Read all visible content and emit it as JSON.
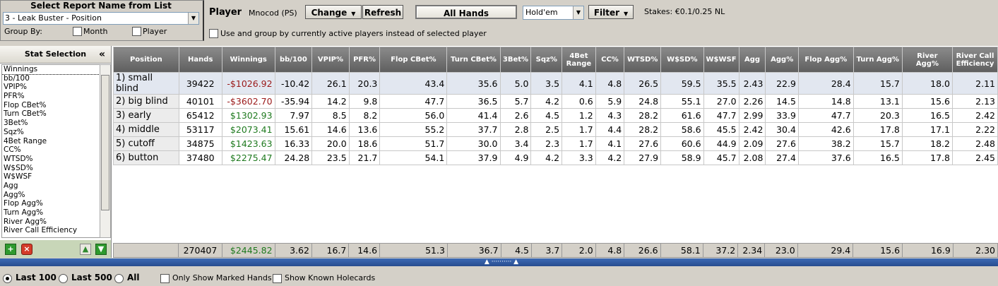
{
  "report": {
    "title": "Select Report Name from List",
    "selected": "3 - Leak Buster - Position",
    "group_by_label": "Group By:",
    "group_month": "Month",
    "group_player": "Player"
  },
  "toolbar": {
    "player_label": "Player",
    "player_name": "Mnocod (PS)",
    "change_label": "Change",
    "refresh_label": "Refresh",
    "all_hands_label": "All Hands",
    "game_selected": "Hold'em",
    "filter_label": "Filter",
    "stakes": "Stakes: €0.1/0.25 NL",
    "active_players_label": "Use and group by currently active players instead of selected player"
  },
  "stat_panel": {
    "title": "Stat Selection",
    "collapse_glyph": "«",
    "items": [
      "Winnings",
      "bb/100",
      "VPIP%",
      "PFR%",
      "Flop CBet%",
      "Turn CBet%",
      "3Bet%",
      "Sqz%",
      "4Bet Range",
      "CC%",
      "WTSD%",
      "W$SD%",
      "W$WSF",
      "Agg",
      "Agg%",
      "Flop Agg%",
      "Turn Agg%",
      "River Agg%",
      "River Call Efficiency"
    ],
    "icons": [
      "add-icon",
      "remove-icon",
      "move-up-icon",
      "move-down-icon"
    ]
  },
  "table": {
    "columns": [
      "Position",
      "Hands",
      "Winnings",
      "bb/100",
      "VPIP%",
      "PFR%",
      "Flop CBet%",
      "Turn CBet%",
      "3Bet%",
      "Sqz%",
      "4Bet Range",
      "CC%",
      "WTSD%",
      "W$SD%",
      "W$WSF",
      "Agg",
      "Agg%",
      "Flop Agg%",
      "Turn Agg%",
      "River Agg%",
      "River Call Efficiency"
    ],
    "rows": [
      [
        "1) small blind",
        "39422",
        "-$1026.92",
        "-10.42",
        "26.1",
        "20.3",
        "43.4",
        "35.6",
        "5.0",
        "3.5",
        "4.1",
        "4.8",
        "26.5",
        "59.5",
        "35.5",
        "2.43",
        "22.9",
        "28.4",
        "15.7",
        "18.0",
        "2.11"
      ],
      [
        "2) big blind",
        "40101",
        "-$3602.70",
        "-35.94",
        "14.2",
        "9.8",
        "47.7",
        "36.5",
        "5.7",
        "4.2",
        "0.6",
        "5.9",
        "24.8",
        "55.1",
        "27.0",
        "2.26",
        "14.5",
        "14.8",
        "13.1",
        "15.6",
        "2.13"
      ],
      [
        "3) early",
        "65412",
        "$1302.93",
        "7.97",
        "8.5",
        "8.2",
        "56.0",
        "41.4",
        "2.6",
        "4.5",
        "1.2",
        "4.3",
        "28.2",
        "61.6",
        "47.7",
        "2.99",
        "33.9",
        "47.7",
        "20.3",
        "16.5",
        "2.42"
      ],
      [
        "4) middle",
        "53117",
        "$2073.41",
        "15.61",
        "14.6",
        "13.6",
        "55.2",
        "37.7",
        "2.8",
        "2.5",
        "1.7",
        "4.4",
        "28.2",
        "58.6",
        "45.5",
        "2.42",
        "30.4",
        "42.6",
        "17.8",
        "17.1",
        "2.22"
      ],
      [
        "5) cutoff",
        "34875",
        "$1423.63",
        "16.33",
        "20.0",
        "18.6",
        "51.7",
        "30.0",
        "3.4",
        "2.3",
        "1.7",
        "4.1",
        "27.6",
        "60.6",
        "44.9",
        "2.09",
        "27.6",
        "38.2",
        "15.7",
        "18.2",
        "2.48"
      ],
      [
        "6) button",
        "37480",
        "$2275.47",
        "24.28",
        "23.5",
        "21.7",
        "54.1",
        "37.9",
        "4.9",
        "4.2",
        "3.3",
        "4.2",
        "27.9",
        "58.9",
        "45.7",
        "2.08",
        "27.4",
        "37.6",
        "16.5",
        "17.8",
        "2.45"
      ]
    ],
    "totals": [
      "",
      "270407",
      "$2445.82",
      "3.62",
      "16.7",
      "14.6",
      "51.3",
      "36.7",
      "4.5",
      "3.7",
      "2.0",
      "4.8",
      "26.6",
      "58.1",
      "37.2",
      "2.34",
      "23.0",
      "29.4",
      "15.6",
      "16.9",
      "2.30"
    ]
  },
  "bottom": {
    "last100": "Last 100",
    "last500": "Last 500",
    "all": "All",
    "marked": "Only Show Marked Hands",
    "holecards": "Show Known Holecards"
  }
}
